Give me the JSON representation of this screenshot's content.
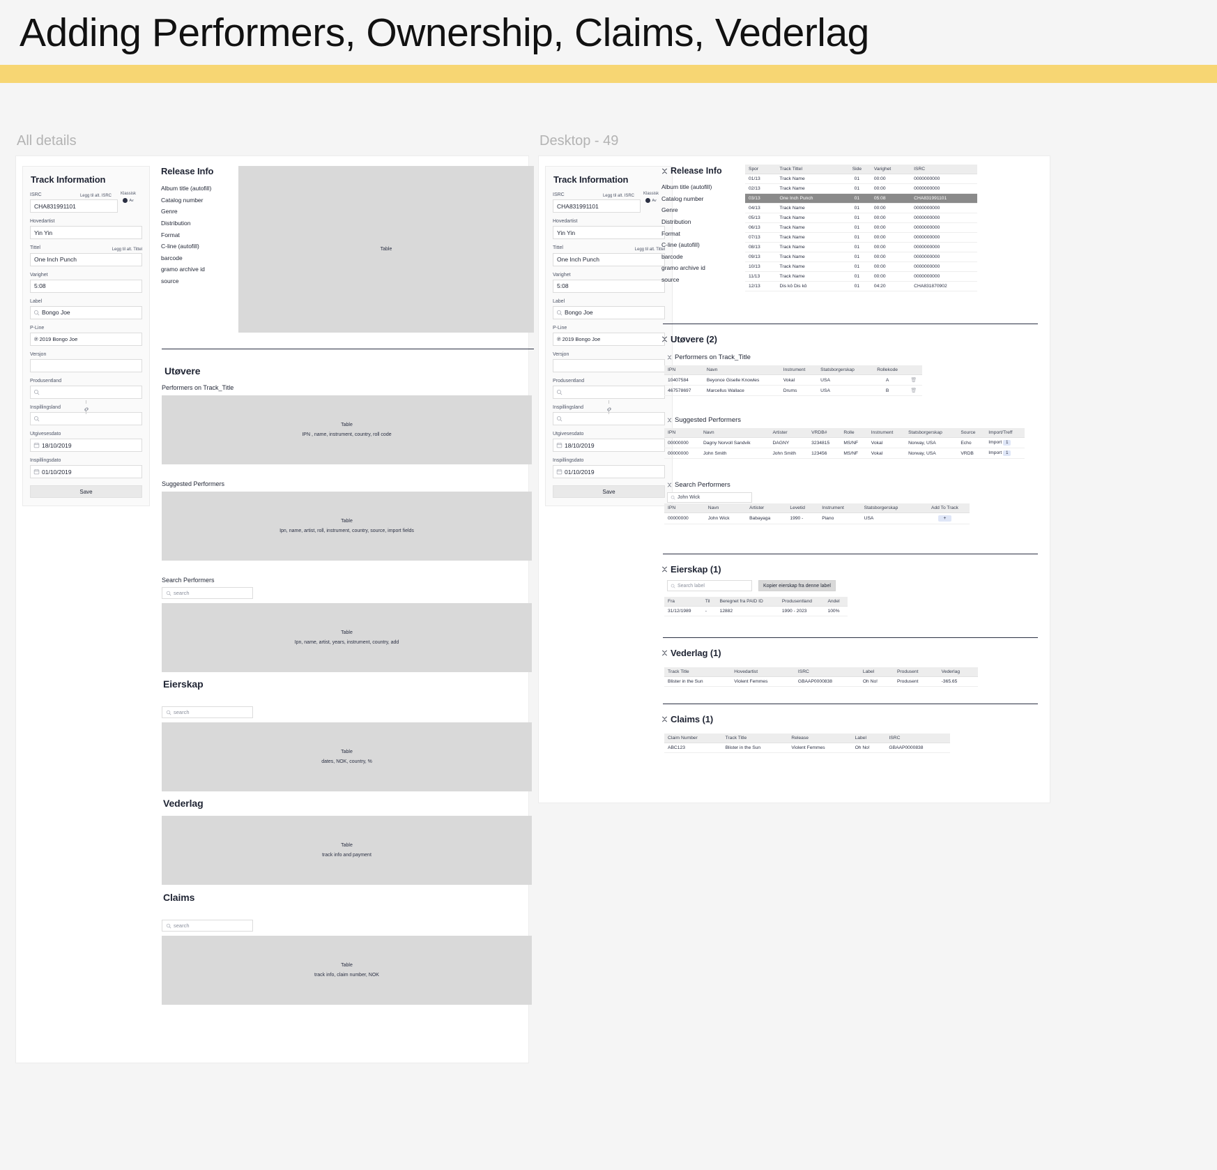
{
  "header": {
    "title": "Adding Performers, Ownership, Claims, Vederlag",
    "accent_color": "#f7d673"
  },
  "frames": {
    "left_label": "All details",
    "right_label": "Desktop - 49"
  },
  "track_information": {
    "heading": "Track Information",
    "isrc_label": "ISRC",
    "isrc_alt_link": "Legg til alt. ISRC",
    "isrc_value": "CHA831991101",
    "klassisk_label": "Klassisk",
    "klassisk_state": "Av",
    "hovedartist_label": "Hovedartist",
    "hovedartist_value": "Yin Yin",
    "tittel_label": "Tittel",
    "tittel_alt_link": "Legg til alt. Tittel",
    "tittel_value": "One Inch Punch",
    "varighet_label": "Varighet",
    "varighet_value": "5:08",
    "label_label": "Label",
    "label_value": "Bongo Joe",
    "pline_label": "P-Line",
    "pline_value": "℗ 2019 Bongo Joe",
    "versjon_label": "Versjon",
    "versjon_value": "",
    "produsentland_label": "Produsentland",
    "produsentland_value": "",
    "inspillingsland_label": "Inspillingsland",
    "inspillingsland_value": "",
    "utgivesesdato_label": "Utgivesesdato",
    "utgivesesdato_value": "18/10/2019",
    "inspillingsdato_label": "Inspillingsdato",
    "inspillingsdato_value": "01/10/2019",
    "save_label": "Save"
  },
  "release_info": {
    "heading": "Release Info",
    "items": [
      "Album title (autofill)",
      "Catalog number",
      "Genre",
      "Distribution",
      "Format",
      "C-line (autofill)",
      "barcode",
      "gramo archive id",
      "source"
    ]
  },
  "left_frame": {
    "hero_table": {
      "title": "Table",
      "subtitle": ""
    },
    "utovere_heading": "Utøvere",
    "performers_on_track_label": "Performers on Track_Title",
    "performers_table": {
      "title": "Table",
      "subtitle": "IPN , name, instrument, country, roll code"
    },
    "suggested_label": "Suggested Performers",
    "suggested_table": {
      "title": "Table",
      "subtitle": "Ipn, name, artist, roll, instrument, country, source, import fields"
    },
    "search_performers_label": "Search Performers",
    "search_placeholder": "search",
    "search_table": {
      "title": "Table",
      "subtitle": "Ipn, name, artist, years, instrument, country, add"
    },
    "eierskap_heading": "Eierskap",
    "eierskap_search_placeholder": "search",
    "eierskap_table": {
      "title": "Table",
      "subtitle": "dates, NOK, country, %"
    },
    "vederlag_heading": "Vederlag",
    "vederlag_table": {
      "title": "Table",
      "subtitle": "track info and payment"
    },
    "claims_heading": "Claims",
    "claims_search_placeholder": "search",
    "claims_table": {
      "title": "Table",
      "subtitle": "track info, claim number, NOK"
    }
  },
  "right_frame": {
    "release_tracks": {
      "columns": [
        "Spor",
        "Track Tittel",
        "Side",
        "Varighet",
        "ISRC"
      ],
      "rows": [
        {
          "spor": "01/13",
          "tittel": "Track Name",
          "side": "01",
          "varighet": "00:00",
          "isrc": "0000000000",
          "selected": false
        },
        {
          "spor": "02/13",
          "tittel": "Track Name",
          "side": "01",
          "varighet": "00:00",
          "isrc": "0000000000",
          "selected": false
        },
        {
          "spor": "03/13",
          "tittel": "One Inch Punch",
          "side": "01",
          "varighet": "05:08",
          "isrc": "CHA831991101",
          "selected": true
        },
        {
          "spor": "04/13",
          "tittel": "Track Name",
          "side": "01",
          "varighet": "00:00",
          "isrc": "0000000000",
          "selected": false
        },
        {
          "spor": "05/13",
          "tittel": "Track Name",
          "side": "01",
          "varighet": "00:00",
          "isrc": "0000000000",
          "selected": false
        },
        {
          "spor": "06/13",
          "tittel": "Track Name",
          "side": "01",
          "varighet": "00:00",
          "isrc": "0000000000",
          "selected": false
        },
        {
          "spor": "07/13",
          "tittel": "Track Name",
          "side": "01",
          "varighet": "00:00",
          "isrc": "0000000000",
          "selected": false
        },
        {
          "spor": "08/13",
          "tittel": "Track Name",
          "side": "01",
          "varighet": "00:00",
          "isrc": "0000000000",
          "selected": false
        },
        {
          "spor": "09/13",
          "tittel": "Track Name",
          "side": "01",
          "varighet": "00:00",
          "isrc": "0000000000",
          "selected": false
        },
        {
          "spor": "10/13",
          "tittel": "Track Name",
          "side": "01",
          "varighet": "00:00",
          "isrc": "0000000000",
          "selected": false
        },
        {
          "spor": "11/13",
          "tittel": "Track Name",
          "side": "01",
          "varighet": "00:00",
          "isrc": "0000000000",
          "selected": false
        },
        {
          "spor": "12/13",
          "tittel": "Dis kô Dis kô",
          "side": "01",
          "varighet": "04:20",
          "isrc": "CHA831870902",
          "selected": false
        }
      ]
    },
    "utovere": {
      "heading": "Utøvere (2)",
      "performers_on_track_label": "Performers on Track_Title",
      "columns": [
        "IPN",
        "Navn",
        "Instrument",
        "Statsborgerskap",
        "Rollekode",
        ""
      ],
      "rows": [
        {
          "ipn": "10407584",
          "navn": "Beyonce Giselle Knowles",
          "instrument": "Vokal",
          "statsborgerskap": "USA",
          "rollekode": "A"
        },
        {
          "ipn": "467578697",
          "navn": "Marcellus Wallace",
          "instrument": "Drums",
          "statsborgerskap": "USA",
          "rollekode": "B"
        }
      ]
    },
    "suggested": {
      "heading": "Suggested Performers",
      "columns": [
        "IPN",
        "Navn",
        "Artister",
        "VRDB#",
        "Rolle",
        "Instrument",
        "Statsborgerskap",
        "Source",
        "Import/Treff"
      ],
      "rows": [
        {
          "ipn": "00000000",
          "navn": "Dagny Norvoll Sandvik",
          "artister": "DAGNY",
          "vrdb": "3234815",
          "rolle": "MS/NF",
          "instrument": "Vokal",
          "statsborgerskap": "Norway, USA",
          "source": "Echo",
          "import": "Import",
          "treff": "1"
        },
        {
          "ipn": "00000000",
          "navn": "John Smith",
          "artister": "John Smith",
          "vrdb": "123456",
          "rolle": "MS/NF",
          "instrument": "Vokal",
          "statsborgerskap": "Norway, USA",
          "source": "VRDB",
          "import": "Import",
          "treff": "1"
        }
      ]
    },
    "search_performers": {
      "heading": "Search Performers",
      "search_value": "John Wick",
      "columns": [
        "IPN",
        "Navn",
        "Artister",
        "Levetid",
        "Instrument",
        "Statsborgerskap",
        "Add To Track"
      ],
      "rows": [
        {
          "ipn": "00000000",
          "navn": "John Wick",
          "artister": "Babayaga",
          "levetid": "1990 -",
          "instrument": "Piano",
          "statsborgerskap": "USA",
          "add": "+"
        }
      ]
    },
    "eierskap": {
      "heading": "Eierskap (1)",
      "search_placeholder": "Search label",
      "copy_button": "Kopier eierskap fra denne label",
      "columns": [
        "Fra",
        "Til",
        "Beregnet fra PAID ID",
        "Produsentland",
        "Andel"
      ],
      "rows": [
        {
          "fra": "31/12/1989",
          "til": "-",
          "paid_id": "12882",
          "produsentland": "1990 - 2023",
          "andel": "100%"
        }
      ]
    },
    "vederlag": {
      "heading": "Vederlag (1)",
      "columns": [
        "Track Title",
        "Hovedartist",
        "ISRC",
        "Label",
        "Produsent",
        "Vederlag"
      ],
      "rows": [
        {
          "track_title": "Blister in the Sun",
          "hovedartist": "Violent Femmes",
          "isrc": "GBAAP0000838",
          "label": "Oh No!",
          "produsent": "Produsent",
          "vederlag": "-365.65"
        }
      ]
    },
    "claims": {
      "heading": "Claims (1)",
      "columns": [
        "Claim Number",
        "Track Title",
        "Release",
        "Label",
        "ISRC"
      ],
      "rows": [
        {
          "claim_number": "ABC123",
          "track_title": "Blister in the Sun",
          "release": "Violent Femmes",
          "label": "Oh No!",
          "isrc": "GBAAP0000838"
        }
      ]
    }
  }
}
